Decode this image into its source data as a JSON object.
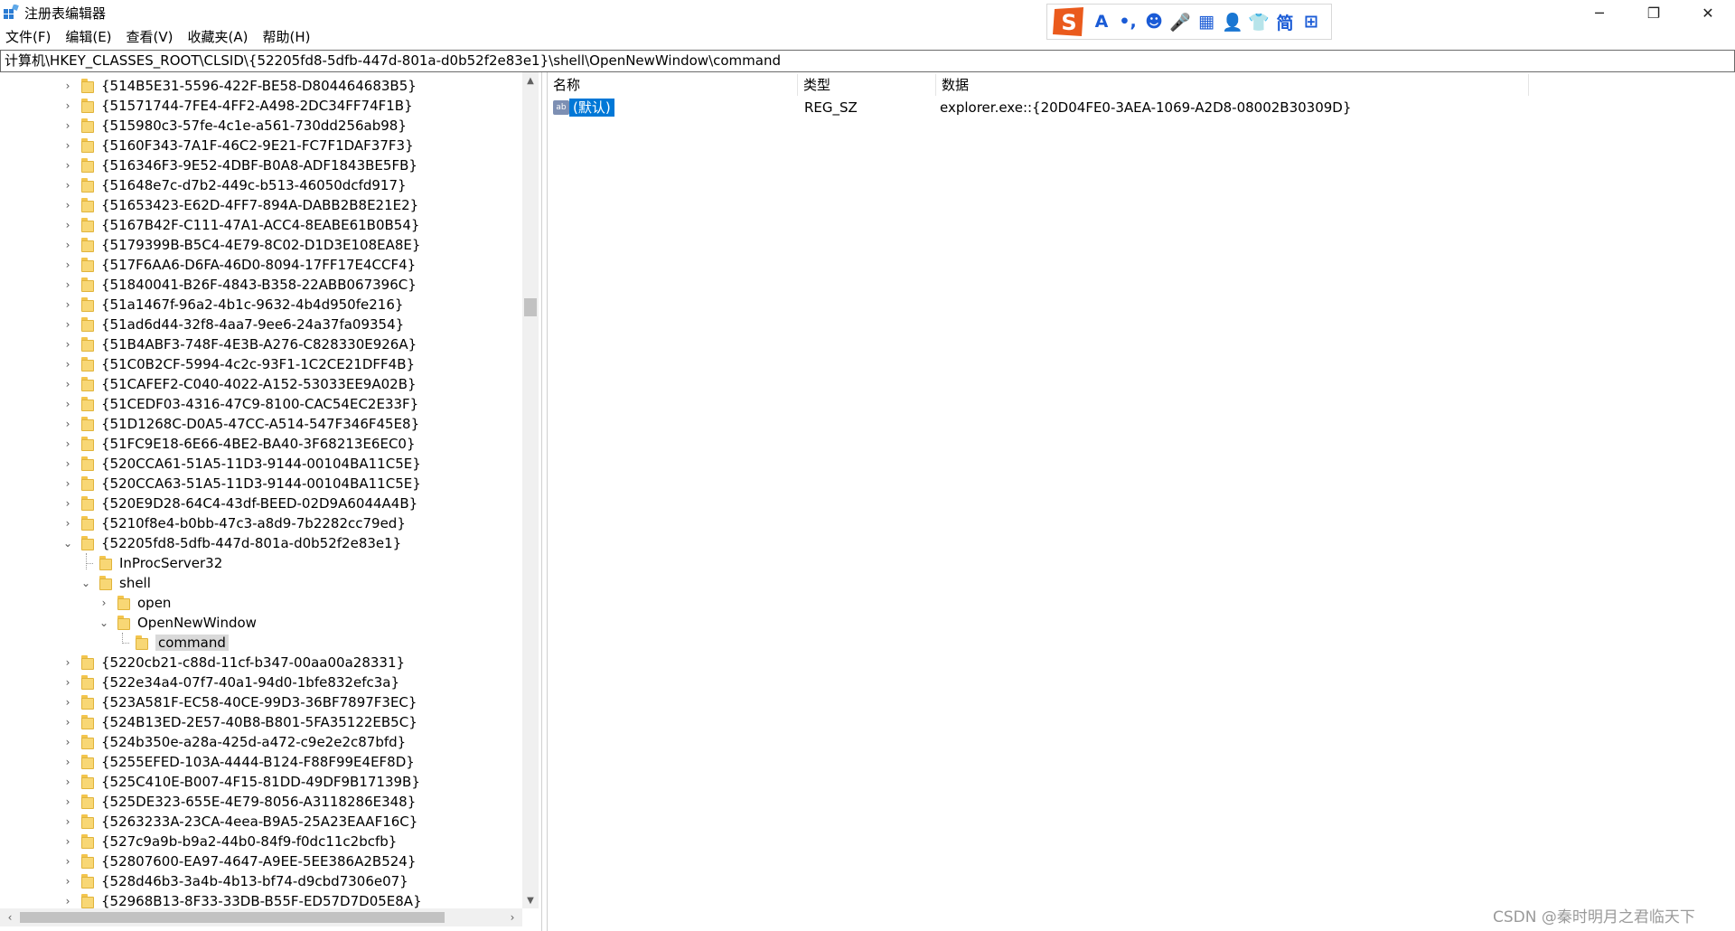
{
  "window": {
    "title": "注册表编辑器",
    "minimize_glyph": "─",
    "maximize_glyph": "❐",
    "close_glyph": "✕"
  },
  "ime_toolbar": {
    "logo": "S",
    "items": [
      {
        "icon": "font-a-icon",
        "glyph": "A"
      },
      {
        "icon": "punctuation-icon",
        "glyph": "•,"
      },
      {
        "icon": "emoji-icon",
        "glyph": "☻"
      },
      {
        "icon": "microphone-icon",
        "glyph": "🎤"
      },
      {
        "icon": "keyboard-icon",
        "glyph": "▦"
      },
      {
        "icon": "user-settings-icon",
        "glyph": "👤"
      },
      {
        "icon": "skin-shirt-icon",
        "glyph": "👕"
      },
      {
        "icon": "simplified-chinese-icon",
        "glyph": "简"
      },
      {
        "icon": "apps-grid-icon",
        "glyph": "⊞"
      }
    ]
  },
  "menu": [
    "文件(F)",
    "编辑(E)",
    "查看(V)",
    "收藏夹(A)",
    "帮助(H)"
  ],
  "address": "计算机\\HKEY_CLASSES_ROOT\\CLSID\\{52205fd8-5dfb-447d-801a-d0b52f2e83e1}\\shell\\OpenNewWindow\\command",
  "tree": [
    {
      "label": "{514B5E31-5596-422F-BE58-D804464683B5}",
      "level": 0,
      "expander": "›"
    },
    {
      "label": "{51571744-7FE4-4FF2-A498-2DC34FF74F1B}",
      "level": 0,
      "expander": "›"
    },
    {
      "label": "{515980c3-57fe-4c1e-a561-730dd256ab98}",
      "level": 0,
      "expander": "›"
    },
    {
      "label": "{5160F343-7A1F-46C2-9E21-FC7F1DAF37F3}",
      "level": 0,
      "expander": "›"
    },
    {
      "label": "{516346F3-9E52-4DBF-B0A8-ADF1843BE5FB}",
      "level": 0,
      "expander": "›"
    },
    {
      "label": "{51648e7c-d7b2-449c-b513-46050dcfd917}",
      "level": 0,
      "expander": "›"
    },
    {
      "label": "{51653423-E62D-4FF7-894A-DABB2B8E21E2}",
      "level": 0,
      "expander": "›"
    },
    {
      "label": "{5167B42F-C111-47A1-ACC4-8EABE61B0B54}",
      "level": 0,
      "expander": "›"
    },
    {
      "label": "{5179399B-B5C4-4E79-8C02-D1D3E108EA8E}",
      "level": 0,
      "expander": "›"
    },
    {
      "label": "{517F6AA6-D6FA-46D0-8094-17FF17E4CCF4}",
      "level": 0,
      "expander": "›"
    },
    {
      "label": "{51840041-B26F-4843-B358-22ABB067396C}",
      "level": 0,
      "expander": "›"
    },
    {
      "label": "{51a1467f-96a2-4b1c-9632-4b4d950fe216}",
      "level": 0,
      "expander": "›"
    },
    {
      "label": "{51ad6d44-32f8-4aa7-9ee6-24a37fa09354}",
      "level": 0,
      "expander": "›"
    },
    {
      "label": "{51B4ABF3-748F-4E3B-A276-C828330E926A}",
      "level": 0,
      "expander": "›"
    },
    {
      "label": "{51C0B2CF-5994-4c2c-93F1-1C2CE21DFF4B}",
      "level": 0,
      "expander": "›"
    },
    {
      "label": "{51CAFEF2-C040-4022-A152-53033EE9A02B}",
      "level": 0,
      "expander": "›"
    },
    {
      "label": "{51CEDF03-4316-47C9-8100-CAC54EC2E33F}",
      "level": 0,
      "expander": "›"
    },
    {
      "label": "{51D1268C-D0A5-47CC-A514-547F346F45E8}",
      "level": 0,
      "expander": "›"
    },
    {
      "label": "{51FC9E18-6E66-4BE2-BA40-3F68213E6EC0}",
      "level": 0,
      "expander": "›"
    },
    {
      "label": "{520CCA61-51A5-11D3-9144-00104BA11C5E}",
      "level": 0,
      "expander": "›"
    },
    {
      "label": "{520CCA63-51A5-11D3-9144-00104BA11C5E}",
      "level": 0,
      "expander": "›"
    },
    {
      "label": "{520E9D28-64C4-43df-BEED-02D9A6044A4B}",
      "level": 0,
      "expander": "›"
    },
    {
      "label": "{5210f8e4-b0bb-47c3-a8d9-7b2282cc79ed}",
      "level": 0,
      "expander": "›"
    },
    {
      "label": "{52205fd8-5dfb-447d-801a-d0b52f2e83e1}",
      "level": 0,
      "expander": "⌄"
    },
    {
      "label": "InProcServer32",
      "level": 1,
      "expander": ""
    },
    {
      "label": "shell",
      "level": 1,
      "expander": "⌄"
    },
    {
      "label": "open",
      "level": 2,
      "expander": "›"
    },
    {
      "label": "OpenNewWindow",
      "level": 2,
      "expander": "⌄"
    },
    {
      "label": "command",
      "level": 3,
      "expander": "",
      "selected": true
    },
    {
      "label": "{5220cb21-c88d-11cf-b347-00aa00a28331}",
      "level": 0,
      "expander": "›"
    },
    {
      "label": "{522e34a4-07f7-40a1-94d0-1bfe832efc3a}",
      "level": 0,
      "expander": "›"
    },
    {
      "label": "{523A581F-EC58-40CE-99D3-36BF7897F3EC}",
      "level": 0,
      "expander": "›"
    },
    {
      "label": "{524B13ED-2E57-40B8-B801-5FA35122EB5C}",
      "level": 0,
      "expander": "›"
    },
    {
      "label": "{524b350e-a28a-425d-a472-c9e2e2c87bfd}",
      "level": 0,
      "expander": "›"
    },
    {
      "label": "{5255EFED-103A-4444-B124-F88F99E4EF8D}",
      "level": 0,
      "expander": "›"
    },
    {
      "label": "{525C410E-B007-4F15-81DD-49DF9B17139B}",
      "level": 0,
      "expander": "›"
    },
    {
      "label": "{525DE323-655E-4E79-8056-A3118286E348}",
      "level": 0,
      "expander": "›"
    },
    {
      "label": "{5263233A-23CA-4eea-B9A5-25A23EAAF16C}",
      "level": 0,
      "expander": "›"
    },
    {
      "label": "{527c9a9b-b9a2-44b0-84f9-f0dc11c2bcfb}",
      "level": 0,
      "expander": "›"
    },
    {
      "label": "{52807600-EA97-4647-A9EE-5EE386A2B524}",
      "level": 0,
      "expander": "›"
    },
    {
      "label": "{528d46b3-3a4b-4b13-bf74-d9cbd7306e07}",
      "level": 0,
      "expander": "›"
    },
    {
      "label": "{52968B13-8F33-33DB-B55F-ED57D7D05E8A}",
      "level": 0,
      "expander": "›"
    }
  ],
  "list": {
    "columns": {
      "name": "名称",
      "type": "类型",
      "data": "数据"
    },
    "rows": [
      {
        "icon": "ab",
        "name": "(默认)",
        "type": "REG_SZ",
        "data": "explorer.exe::{20D04FE0-3AEA-1069-A2D8-08002B30309D}"
      }
    ]
  },
  "scroll": {
    "up": "▲",
    "down": "▼",
    "left": "‹",
    "right": "›"
  },
  "watermark": "CSDN @秦时明月之君临天下"
}
